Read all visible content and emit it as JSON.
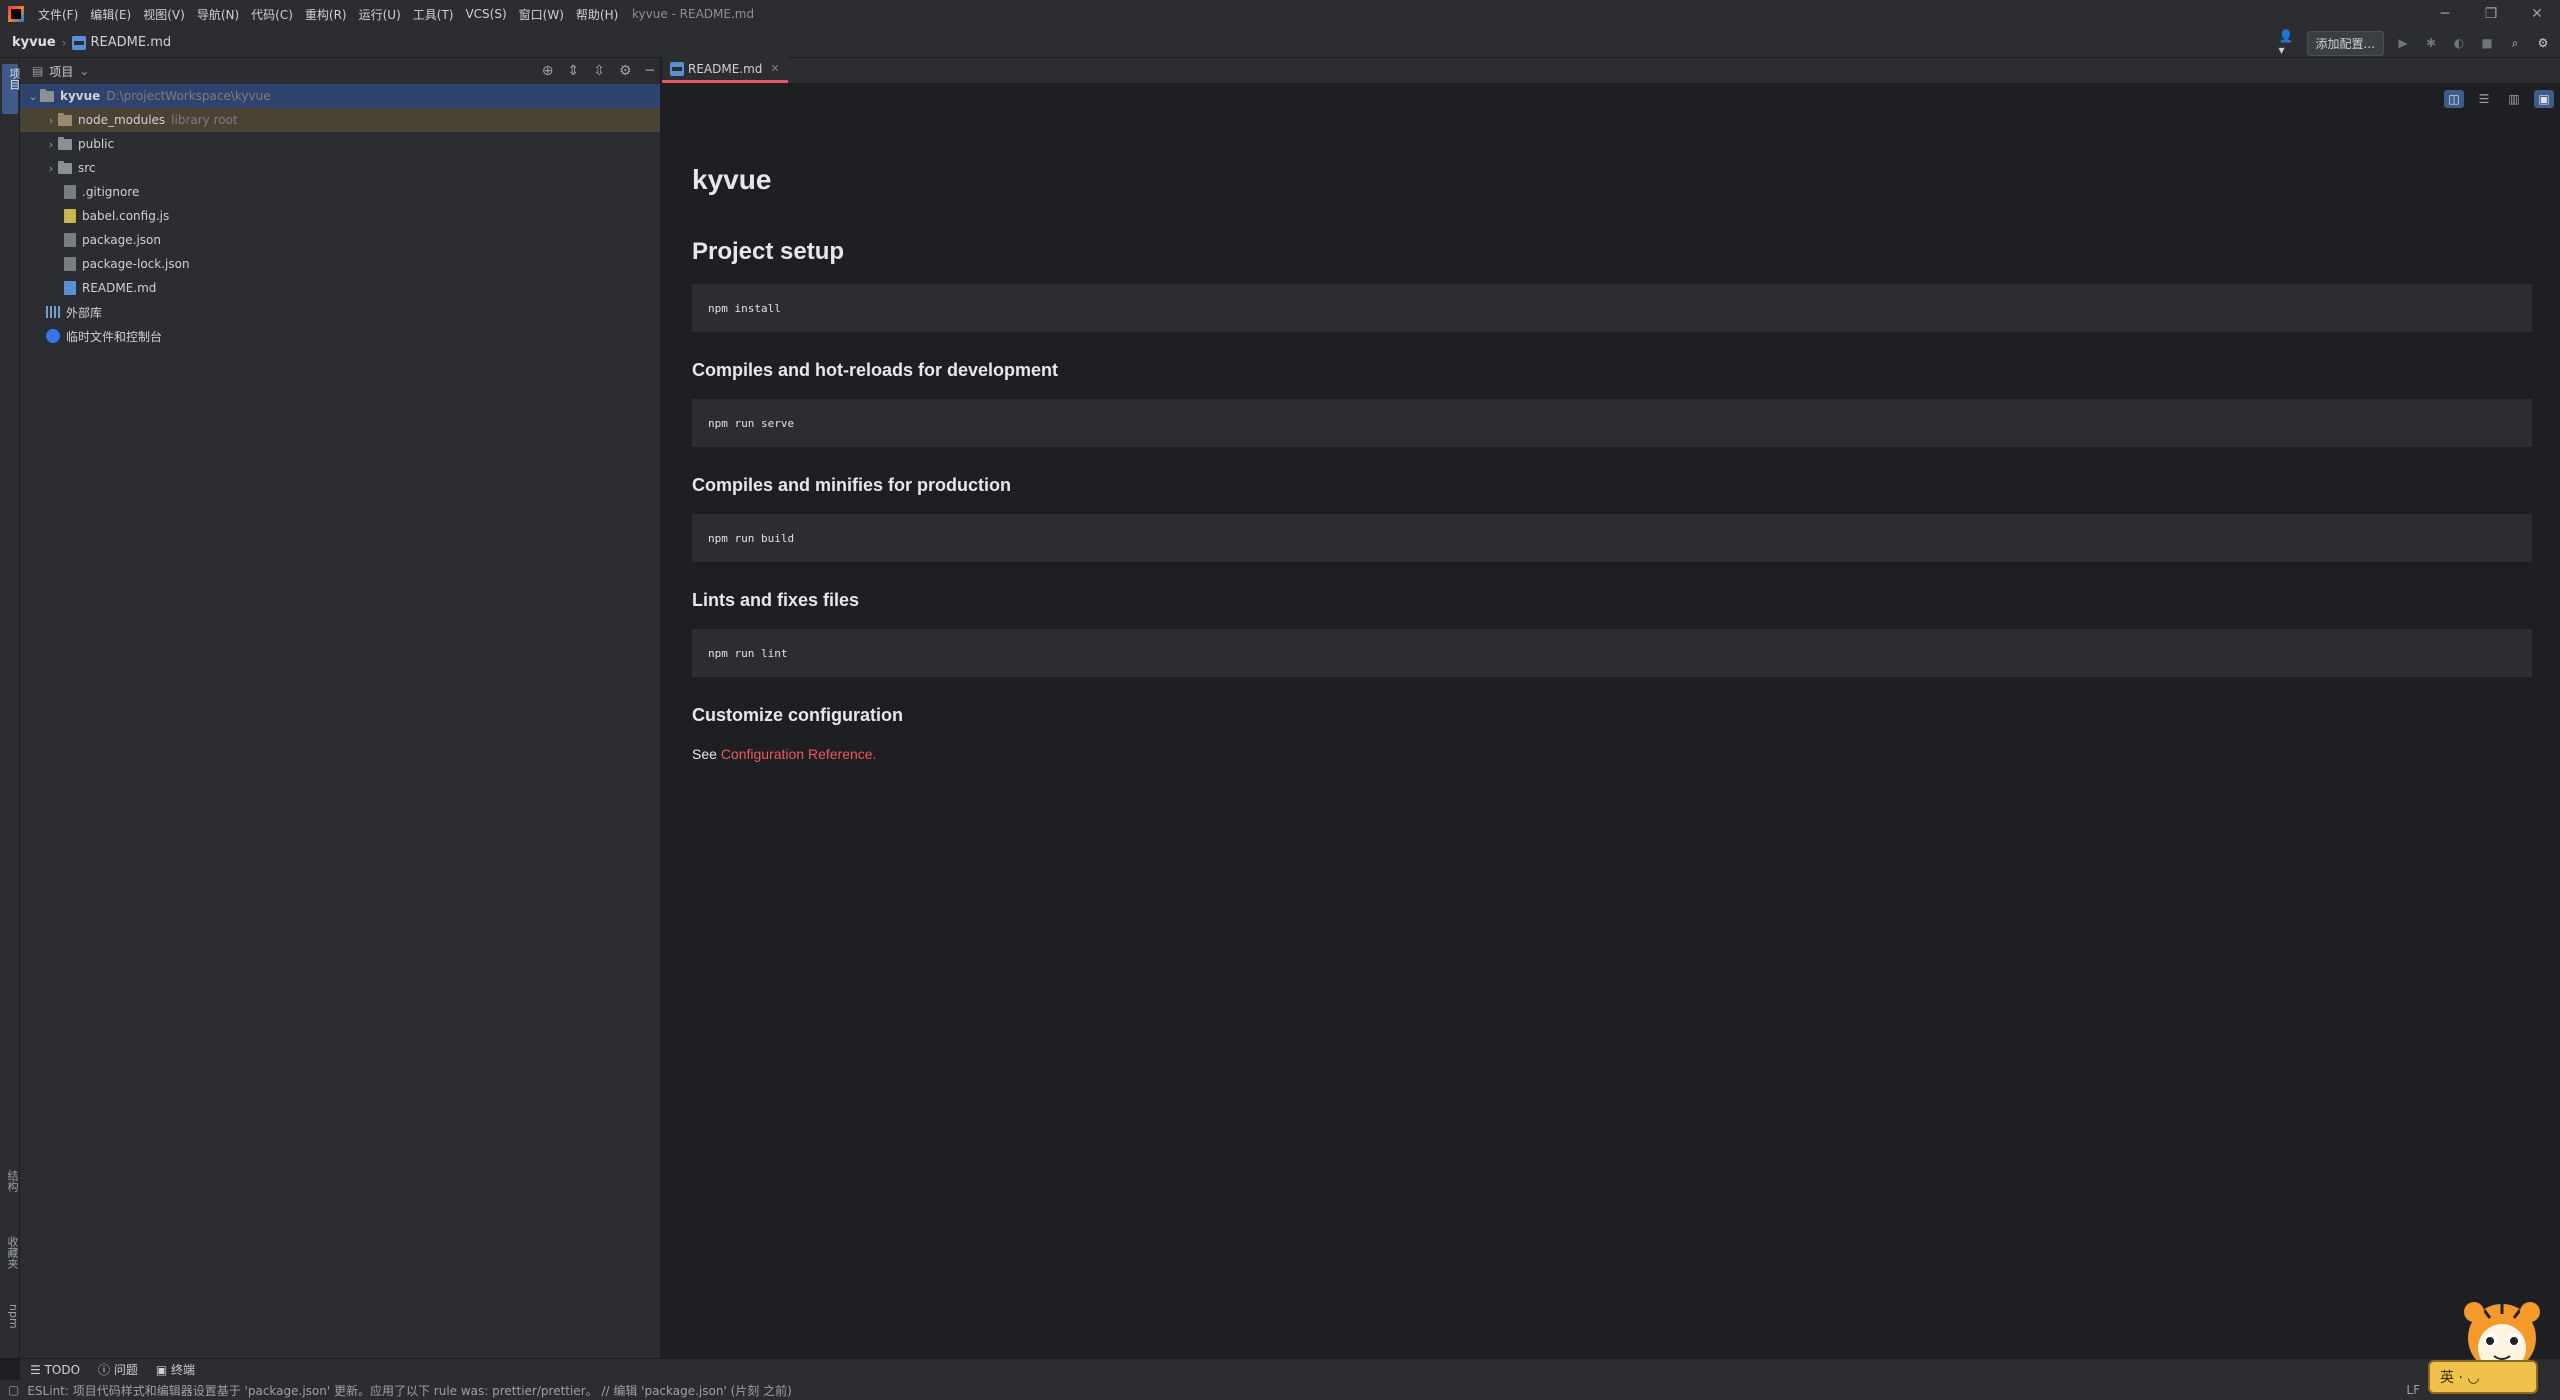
{
  "menubar": {
    "items": [
      "文件(F)",
      "编辑(E)",
      "视图(V)",
      "导航(N)",
      "代码(C)",
      "重构(R)",
      "运行(U)",
      "工具(T)",
      "VCS(S)",
      "窗口(W)",
      "帮助(H)"
    ],
    "window_title": "kyvue - README.md"
  },
  "navbar": {
    "project": "kyvue",
    "file": "README.md",
    "add_config": "添加配置..."
  },
  "left_strip": {
    "top_label": "项目",
    "bottom_labels": [
      "结构",
      "收藏夹",
      "npm"
    ]
  },
  "project_panel": {
    "title": "项目",
    "tree": [
      {
        "name": "kyvue",
        "hint": "D:\\projectWorkspace\\kyvue"
      },
      {
        "name": "node_modules",
        "hint": "library root"
      },
      {
        "name": "public"
      },
      {
        "name": "src"
      },
      {
        "name": ".gitignore"
      },
      {
        "name": "babel.config.js"
      },
      {
        "name": "package.json"
      },
      {
        "name": "package-lock.json"
      },
      {
        "name": "README.md"
      },
      {
        "name": "外部库"
      },
      {
        "name": "临时文件和控制台"
      }
    ]
  },
  "editor": {
    "tab": "README.md",
    "doc": {
      "h1": "kyvue",
      "h2": "Project setup",
      "code1": "npm install",
      "h3_1": "Compiles and hot-reloads for development",
      "code2": "npm run serve",
      "h3_2": "Compiles and minifies for production",
      "code3": "npm run build",
      "h3_3": "Lints and fixes files",
      "code4": "npm run lint",
      "h3_4": "Customize configuration",
      "p_prefix": "See ",
      "link": "Configuration Reference",
      "p_suffix": "."
    }
  },
  "bottom_tools": [
    "TODO",
    "问题",
    "终端"
  ],
  "status": {
    "message": "ESLint: 项目代码样式和编辑器设置基于 'package.json' 更新。应用了以下 rule was: prettier/prettier。 // 编辑 'package.json' (片刻 之前)",
    "line_sep": "LF"
  },
  "mascot": {
    "badge": "英 · ◡"
  }
}
